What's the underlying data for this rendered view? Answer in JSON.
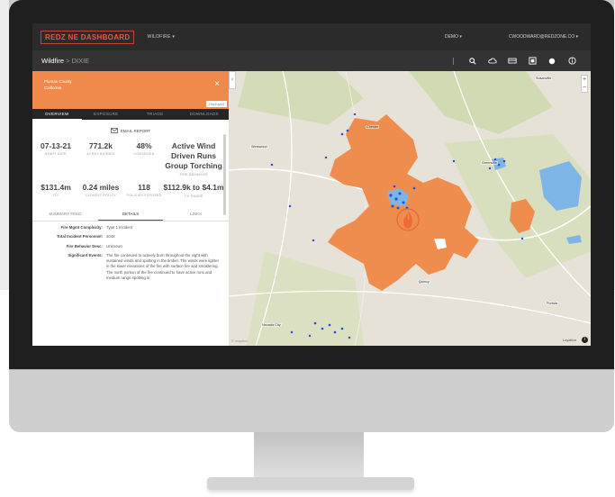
{
  "app": {
    "logo_text": "REDZ NE DASHBOARD",
    "menu_label": "WILDFIRE ▾",
    "demo_label": "DEMO ▾",
    "user_label": "CWOODWARD@REDZONE.CO ▾"
  },
  "breadcrumb": {
    "section": "Wildfire",
    "separator": ">",
    "current": "DIXIE"
  },
  "panel": {
    "location_line1": "Plumas County",
    "location_line2": "California",
    "close_glyph": "×",
    "deployed_label": "Deployed",
    "tabs": [
      "OVERVIEW",
      "EXPOSURE",
      "TRIAGE",
      "DOWNLOADS"
    ],
    "email_label": "EMAIL REPORT",
    "stats_row1": [
      {
        "value": "07-13-21",
        "label": "START DATE"
      },
      {
        "value": "771.2k",
        "label": "ACRES BURNED"
      },
      {
        "value": "48%",
        "label": "CONTAINED"
      },
      {
        "value": "Active Wind Driven Runs Group Torching",
        "label": "FIRE BEHAVIOR"
      }
    ],
    "stats_row2": [
      {
        "value": "$131.4m",
        "label": "TIV"
      },
      {
        "value": "0.24 miles",
        "label": "CLOSEST POLICY"
      },
      {
        "value": "118",
        "label": "POLICIES EXPOSED"
      },
      {
        "value": "$112.9k to $4.1m",
        "label": "TIV RANGE"
      }
    ],
    "subtabs": [
      "SUMMARY FEED",
      "DETAILS",
      "LINKS"
    ],
    "details": [
      {
        "key": "Fire Mgmt Complexity:",
        "value": "Type 1 Incident"
      },
      {
        "key": "Total Incident Personnel:",
        "value": "4048"
      },
      {
        "key": "Fire Behavior Desc:",
        "value": "Unknown"
      },
      {
        "key": "Significant Events:",
        "value": "The fire continued to actively burn throughout the night with sustained winds and spotting in the timber. The winds were lighter in the lower elevations of the fire with surface fire and smoldering. The north portion of the fire continued to have active runs and medium range spotting in"
      }
    ]
  },
  "map": {
    "towns": [
      "Westwood",
      "Chester",
      "Greenville",
      "Quincy",
      "Portola",
      "Nevada City",
      "Susanville"
    ],
    "zoom_in": "+",
    "zoom_out": "−",
    "logo": "© mapbox",
    "location_label": "Loyalton",
    "info_glyph": "i",
    "colors": {
      "perimeter": "#ef8d4e",
      "water": "#7fb4e6",
      "points": "#2b49d8",
      "forest": "#c9d7a7"
    }
  }
}
